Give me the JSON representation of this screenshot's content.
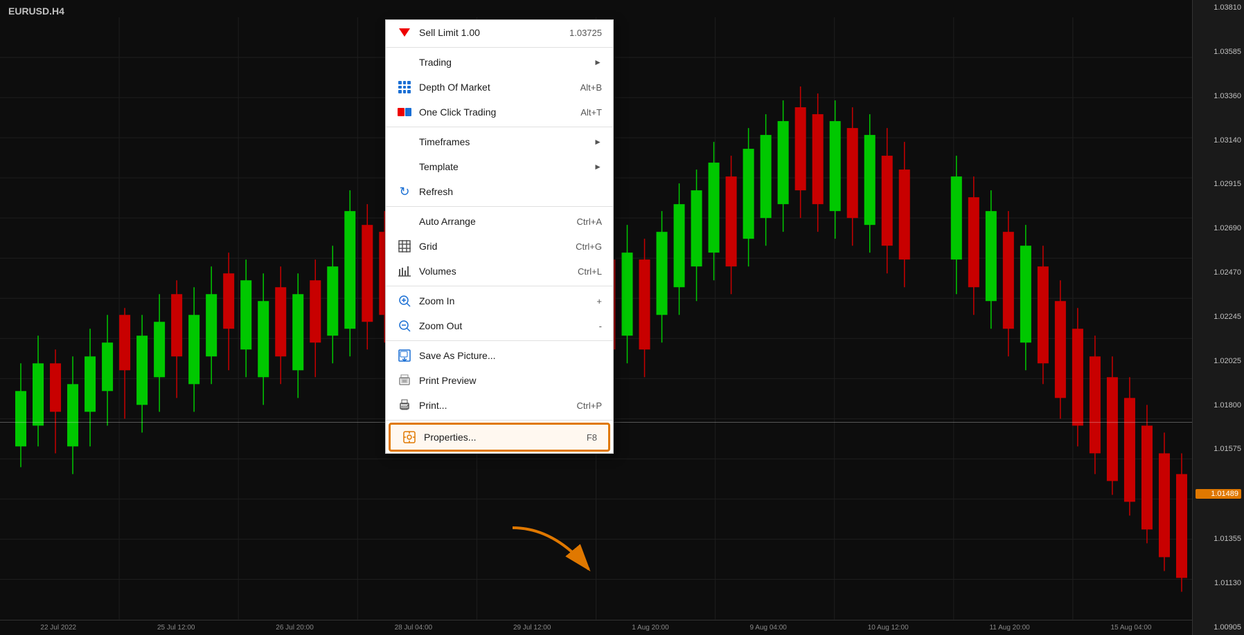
{
  "chart": {
    "title": "EURUSD.H4",
    "background_color": "#0d0d0d",
    "crosshair_price": "1.01489",
    "price_labels": [
      "1.03810",
      "1.03585",
      "1.03360",
      "1.03140",
      "1.02915",
      "1.02690",
      "1.02470",
      "1.02245",
      "1.02025",
      "1.01800",
      "1.01575",
      "1.01489",
      "1.01355",
      "1.01130",
      "1.00905"
    ],
    "time_labels": [
      "22 Jul 2022",
      "25 Jul 12:00",
      "26 Jul 20:00",
      "28 Jul 04:00",
      "29 Jul 12:00",
      "1 Aug 20:00",
      "9 Aug 04:00",
      "10 Aug 12:00",
      "11 Aug 20:00",
      "15 Aug 04:00"
    ]
  },
  "context_menu": {
    "items": [
      {
        "id": "sell-limit",
        "label": "Sell Limit 1.00",
        "shortcut": "1.03725",
        "icon": "sell-limit-icon",
        "has_arrow": false,
        "has_separator_after": true
      },
      {
        "id": "trading",
        "label": "Trading",
        "shortcut": "",
        "icon": "",
        "has_arrow": true,
        "has_separator_after": false
      },
      {
        "id": "depth-of-market",
        "label": "Depth Of Market",
        "shortcut": "Alt+B",
        "icon": "depth-icon",
        "has_arrow": false,
        "has_separator_after": false
      },
      {
        "id": "one-click-trading",
        "label": "One Click Trading",
        "shortcut": "Alt+T",
        "icon": "oneclick-icon",
        "has_arrow": false,
        "has_separator_after": true
      },
      {
        "id": "timeframes",
        "label": "Timeframes",
        "shortcut": "",
        "icon": "",
        "has_arrow": true,
        "has_separator_after": false
      },
      {
        "id": "template",
        "label": "Template",
        "shortcut": "",
        "icon": "",
        "has_arrow": true,
        "has_separator_after": false
      },
      {
        "id": "refresh",
        "label": "Refresh",
        "shortcut": "",
        "icon": "refresh-icon",
        "has_arrow": false,
        "has_separator_after": true
      },
      {
        "id": "auto-arrange",
        "label": "Auto Arrange",
        "shortcut": "Ctrl+A",
        "icon": "",
        "has_arrow": false,
        "has_separator_after": false
      },
      {
        "id": "grid",
        "label": "Grid",
        "shortcut": "Ctrl+G",
        "icon": "grid-icon",
        "has_arrow": false,
        "has_separator_after": false
      },
      {
        "id": "volumes",
        "label": "Volumes",
        "shortcut": "Ctrl+L",
        "icon": "volumes-icon",
        "has_arrow": false,
        "has_separator_after": true
      },
      {
        "id": "zoom-in",
        "label": "Zoom In",
        "shortcut": "+",
        "icon": "zoom-in-icon",
        "has_arrow": false,
        "has_separator_after": false
      },
      {
        "id": "zoom-out",
        "label": "Zoom Out",
        "shortcut": "-",
        "icon": "zoom-out-icon",
        "has_arrow": false,
        "has_separator_after": true
      },
      {
        "id": "save-as-picture",
        "label": "Save As Picture...",
        "shortcut": "",
        "icon": "save-icon",
        "has_arrow": false,
        "has_separator_after": false
      },
      {
        "id": "print-preview",
        "label": "Print Preview",
        "shortcut": "",
        "icon": "print-preview-icon",
        "has_arrow": false,
        "has_separator_after": false
      },
      {
        "id": "print",
        "label": "Print...",
        "shortcut": "Ctrl+P",
        "icon": "print-icon",
        "has_arrow": false,
        "has_separator_after": true
      },
      {
        "id": "properties",
        "label": "Properties...",
        "shortcut": "F8",
        "icon": "properties-icon",
        "has_arrow": false,
        "highlighted": true,
        "has_separator_after": false
      }
    ]
  },
  "annotation": {
    "arrow_color": "#e07800",
    "arrow_points_to": "properties"
  }
}
